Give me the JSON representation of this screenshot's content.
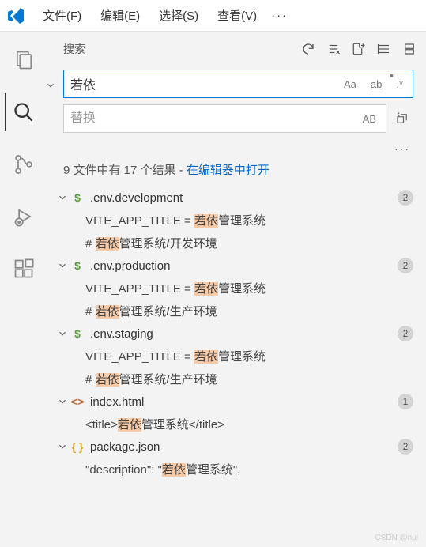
{
  "menubar": {
    "items": [
      "文件(F)",
      "编辑(E)",
      "选择(S)",
      "查看(V)"
    ],
    "overflow": "···"
  },
  "sidebar": {
    "title": "搜索",
    "search_value": "若依",
    "replace_placeholder": "替换",
    "case_label": "Aa",
    "word_label": "ab",
    "regex_label": ".*",
    "preserve_case_label": "AB",
    "more": "···"
  },
  "summary": {
    "text_prefix": "9 文件中有 17 个结果 - ",
    "link": "在编辑器中打开"
  },
  "files": [
    {
      "icon_type": "env",
      "icon": "$",
      "name": ".env.development",
      "count": "2",
      "matches": [
        {
          "pre": "VITE_APP_TITLE = ",
          "hl": "若依",
          "post": "管理系统"
        },
        {
          "pre": "# ",
          "hl": "若依",
          "post": "管理系统/开发环境"
        }
      ]
    },
    {
      "icon_type": "env",
      "icon": "$",
      "name": ".env.production",
      "count": "2",
      "matches": [
        {
          "pre": "VITE_APP_TITLE = ",
          "hl": "若依",
          "post": "管理系统"
        },
        {
          "pre": "# ",
          "hl": "若依",
          "post": "管理系统/生产环境"
        }
      ]
    },
    {
      "icon_type": "env",
      "icon": "$",
      "name": ".env.staging",
      "count": "2",
      "matches": [
        {
          "pre": "VITE_APP_TITLE = ",
          "hl": "若依",
          "post": "管理系统"
        },
        {
          "pre": "# ",
          "hl": "若依",
          "post": "管理系统/生产环境"
        }
      ]
    },
    {
      "icon_type": "html",
      "icon": "<>",
      "name": "index.html",
      "count": "1",
      "matches": [
        {
          "pre": "<title>",
          "hl": "若依",
          "post": "管理系统</title>"
        }
      ]
    },
    {
      "icon_type": "json",
      "icon": "{ }",
      "name": "package.json",
      "count": "2",
      "matches": [
        {
          "pre": "\"description\": \"",
          "hl": "若依",
          "post": "管理系统\","
        }
      ]
    }
  ],
  "watermark": "CSDN @nul"
}
